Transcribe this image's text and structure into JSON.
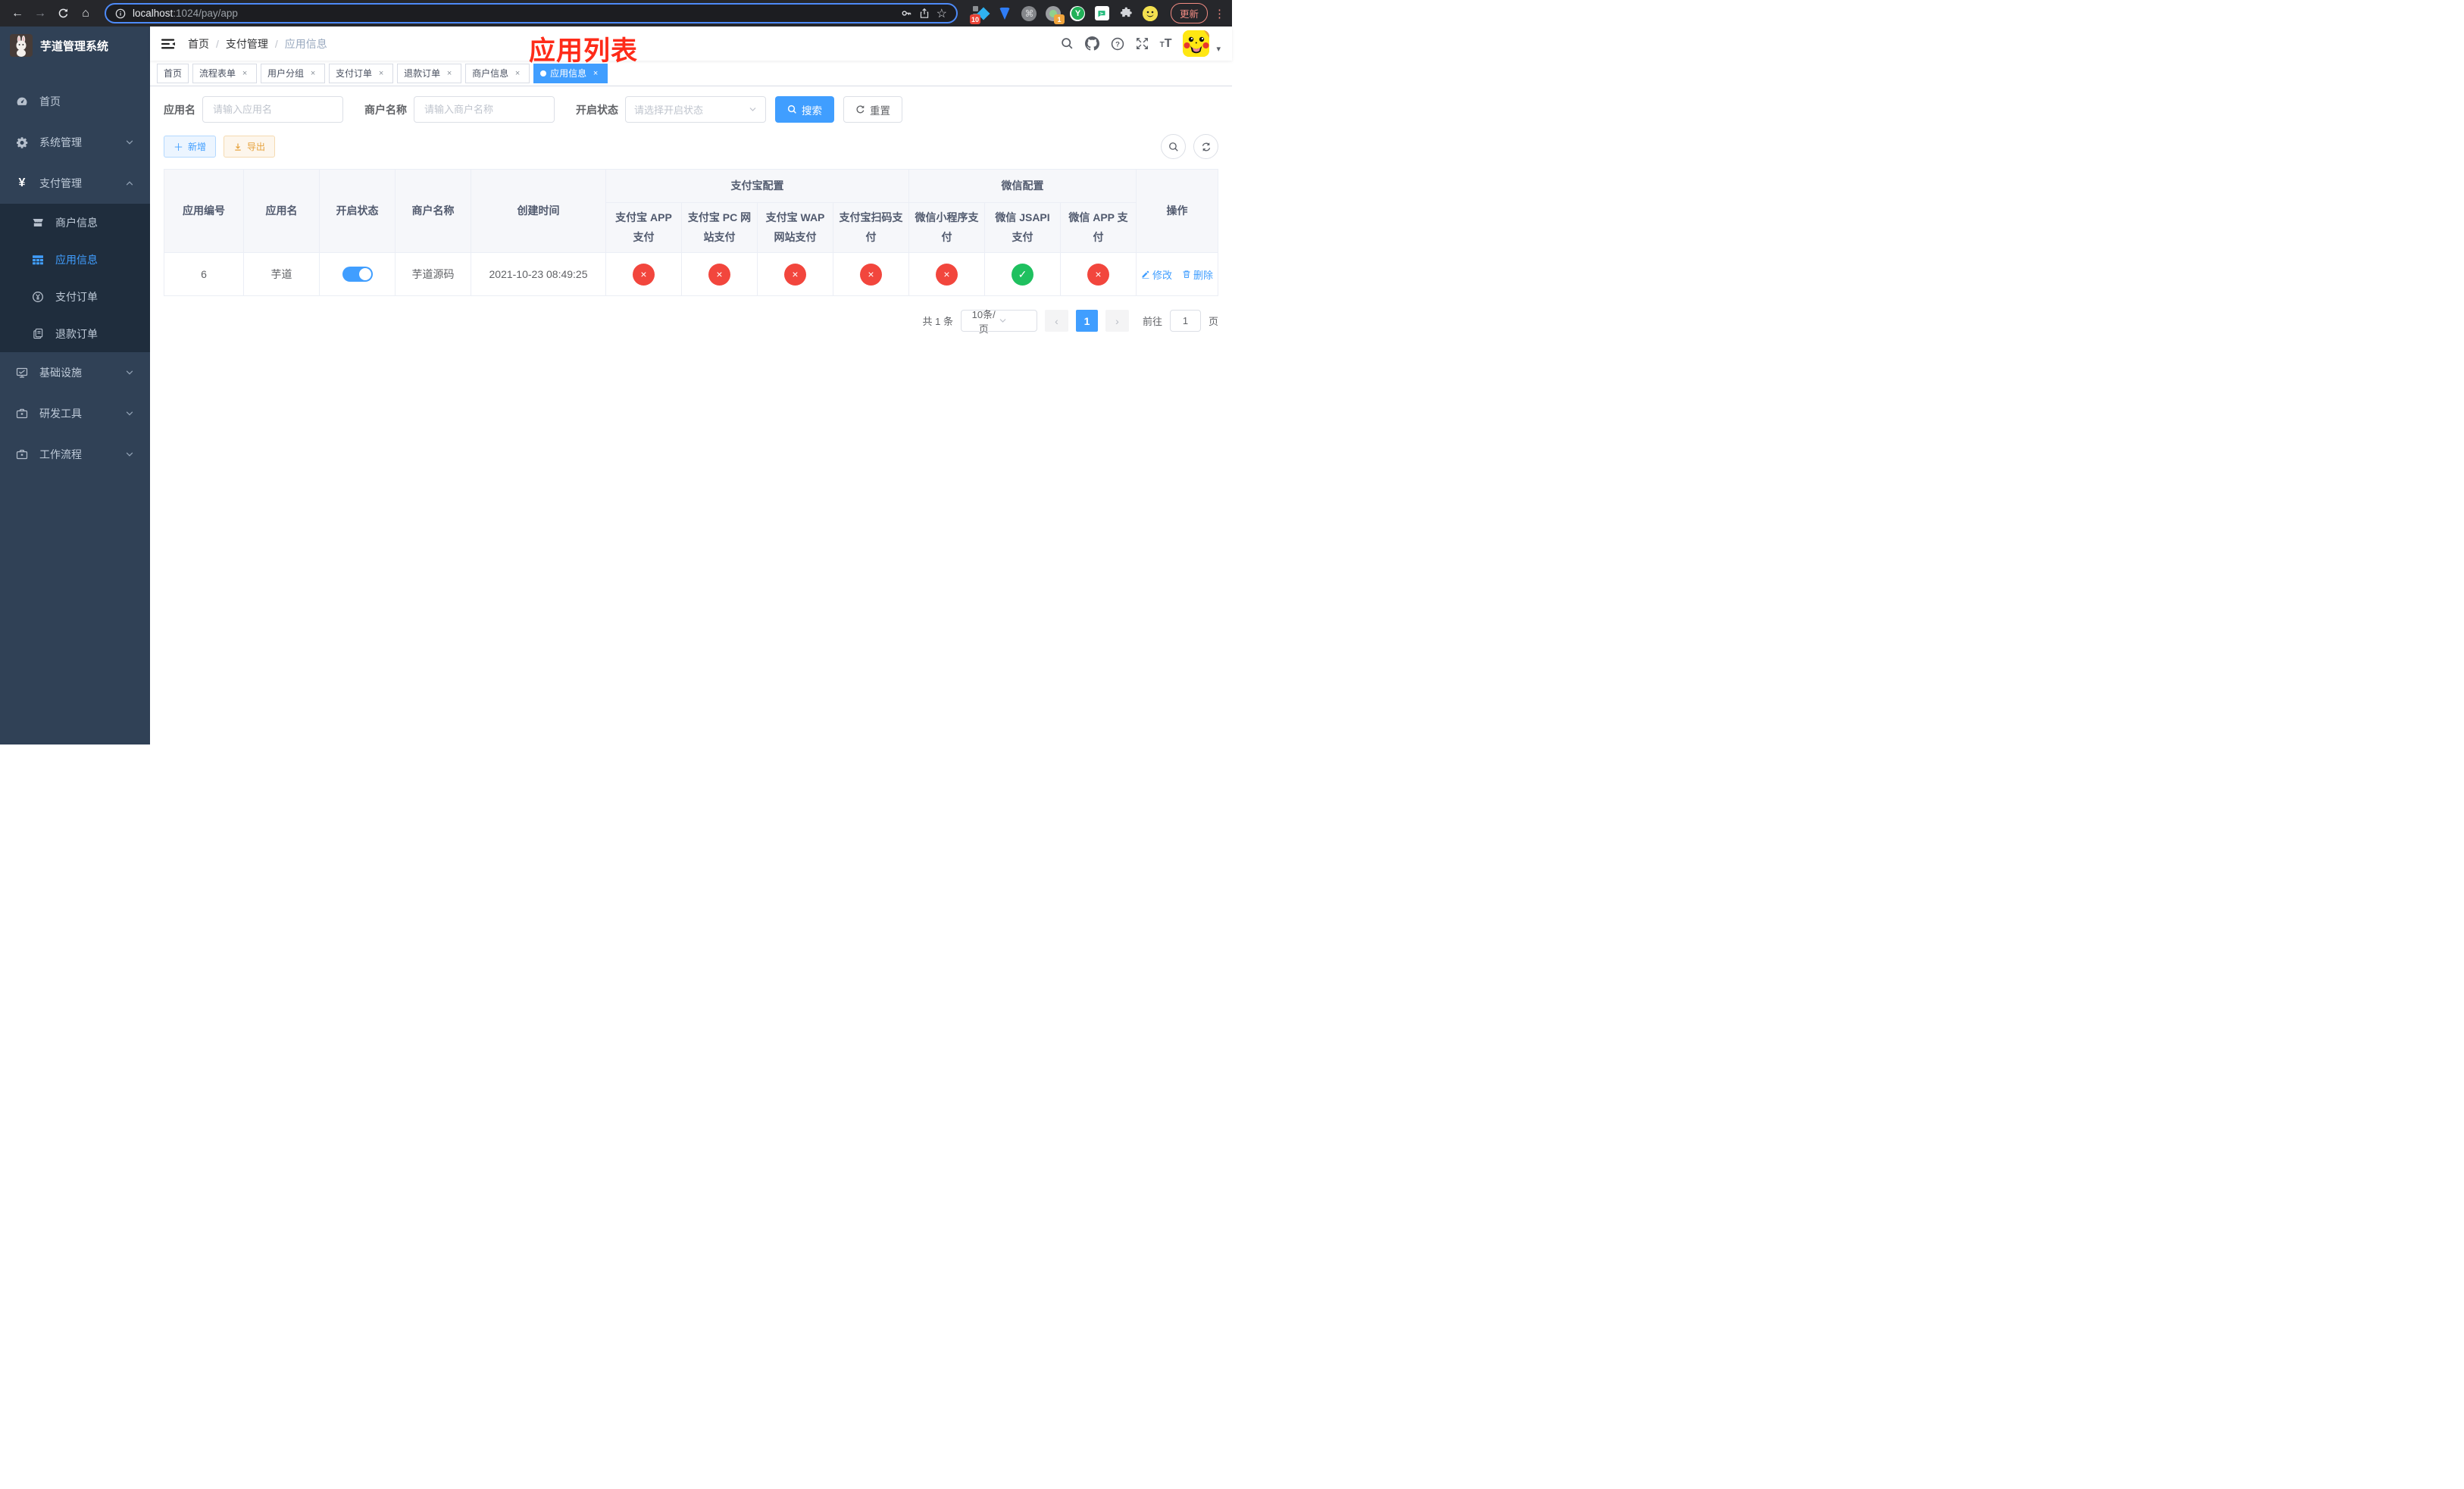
{
  "browser": {
    "url": {
      "host": "localhost",
      "rest": ":1024/pay/app"
    },
    "update_button": "更新",
    "extension_badge_pinned": "10",
    "extension_badge_session": "1"
  },
  "sidebar": {
    "title": "芋道管理系统",
    "items": {
      "home": "首页",
      "system": "系统管理",
      "payment": "支付管理",
      "merchant_info": "商户信息",
      "app_info": "应用信息",
      "pay_order": "支付订单",
      "refund_order": "退款订单",
      "infrastructure": "基础设施",
      "dev_tools": "研发工具",
      "workflow": "工作流程"
    }
  },
  "navbar": {
    "breadcrumb": [
      "首页",
      "支付管理",
      "应用信息"
    ],
    "overlay_title": "应用列表"
  },
  "tabs": [
    {
      "label": "首页",
      "closable": false,
      "active": false
    },
    {
      "label": "流程表单",
      "closable": true,
      "active": false
    },
    {
      "label": "用户分组",
      "closable": true,
      "active": false
    },
    {
      "label": "支付订单",
      "closable": true,
      "active": false
    },
    {
      "label": "退款订单",
      "closable": true,
      "active": false
    },
    {
      "label": "商户信息",
      "closable": true,
      "active": false
    },
    {
      "label": "应用信息",
      "closable": true,
      "active": true
    }
  ],
  "filters": {
    "app_name_label": "应用名",
    "app_name_placeholder": "请输入应用名",
    "merchant_label": "商户名称",
    "merchant_placeholder": "请输入商户名称",
    "status_label": "开启状态",
    "status_placeholder": "请选择开启状态",
    "search_button": "搜索",
    "reset_button": "重置"
  },
  "toolbar": {
    "add_button": "新增",
    "export_button": "导出"
  },
  "table": {
    "headers": {
      "app_id": "应用编号",
      "app_name": "应用名",
      "status": "开启状态",
      "merchant": "商户名称",
      "created_at": "创建时间",
      "actions": "操作"
    },
    "group_headers": {
      "alipay": "支付宝配置",
      "wechat": "微信配置"
    },
    "sub_headers": [
      "支付宝 APP 支付",
      "支付宝 PC 网站支付",
      "支付宝 WAP 网站支付",
      "支付宝扫码支付",
      "微信小程序支付",
      "微信 JSAPI 支付",
      "微信 APP 支付"
    ],
    "status_glyphs": {
      "yes": "✓",
      "no": "×"
    },
    "row": {
      "app_id": "6",
      "app_name": "芋道",
      "enabled": true,
      "merchant": "芋道源码",
      "created_at": "2021-10-23 08:49:25",
      "statuses": [
        "no",
        "no",
        "no",
        "no",
        "no",
        "yes",
        "no"
      ],
      "edit_label": "修改",
      "delete_label": "删除"
    }
  },
  "pagination": {
    "total": "共 1 条",
    "page_size": "10条/页",
    "current_page": "1",
    "goto_label": "前往",
    "goto_value": "1",
    "page_unit": "页"
  },
  "colors": {
    "primary": "#409eff",
    "success": "#1fc05f",
    "danger": "#f2463d",
    "warning": "#e6a23c",
    "sidebar_bg": "#304156",
    "submenu_bg": "#1f2d3d",
    "overlay_red": "#fe2b19"
  }
}
